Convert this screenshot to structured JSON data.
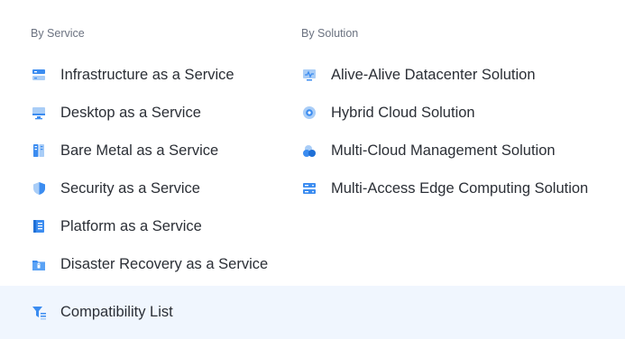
{
  "by_service": {
    "heading": "By Service",
    "items": [
      {
        "label": "Infrastructure as a Service",
        "icon": "server-rack-icon"
      },
      {
        "label": "Desktop as a Service",
        "icon": "monitor-icon"
      },
      {
        "label": "Bare Metal as a Service",
        "icon": "bare-metal-server-icon"
      },
      {
        "label": "Security as a Service",
        "icon": "shield-icon"
      },
      {
        "label": "Platform as a Service",
        "icon": "platform-book-icon"
      },
      {
        "label": "Disaster Recovery as a Service",
        "icon": "folder-lock-icon"
      }
    ]
  },
  "by_solution": {
    "heading": "By Solution",
    "items": [
      {
        "label": "Alive-Alive Datacenter Solution",
        "icon": "datacenter-monitor-icon"
      },
      {
        "label": "Hybrid Cloud Solution",
        "icon": "hybrid-cloud-icon"
      },
      {
        "label": "Multi-Cloud Management Solution",
        "icon": "multi-cloud-icon"
      },
      {
        "label": "Multi-Access Edge Computing Solution",
        "icon": "edge-server-icon"
      }
    ]
  },
  "footer": {
    "label": "Compatibility List",
    "icon": "compatibility-filter-icon"
  },
  "colors": {
    "icon_primary": "#3b8cf0",
    "icon_light": "#a9cdf7",
    "footer_bg": "#f0f6fe",
    "heading": "#6b7280",
    "text": "#2b2f36"
  }
}
